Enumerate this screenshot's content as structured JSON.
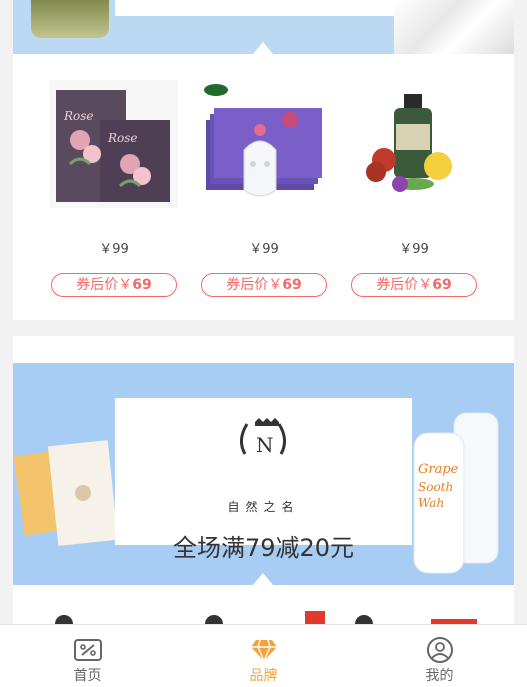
{
  "products": [
    {
      "price": "￥99",
      "coupon_prefix": "券后价￥",
      "coupon_value": "69",
      "image": "rose-mask-box"
    },
    {
      "price": "￥99",
      "coupon_prefix": "券后价￥",
      "coupon_value": "69",
      "image": "afu-sheet-mask"
    },
    {
      "price": "￥99",
      "coupon_prefix": "券后价￥",
      "coupon_value": "69",
      "image": "aroma-oil-bottle"
    }
  ],
  "brand_banner": {
    "logo_letter": "N",
    "brand_name": "自然之名",
    "promo": "全场满79减20元"
  },
  "tabbar": {
    "items": [
      {
        "label": "首页",
        "icon": "discount-icon",
        "active": false
      },
      {
        "label": "品牌",
        "icon": "diamond-icon",
        "active": true
      },
      {
        "label": "我的",
        "icon": "user-icon",
        "active": false
      }
    ]
  },
  "colors": {
    "accent": "#f6a23a",
    "coupon": "#f26a67",
    "banner": "#a8cdf4"
  }
}
